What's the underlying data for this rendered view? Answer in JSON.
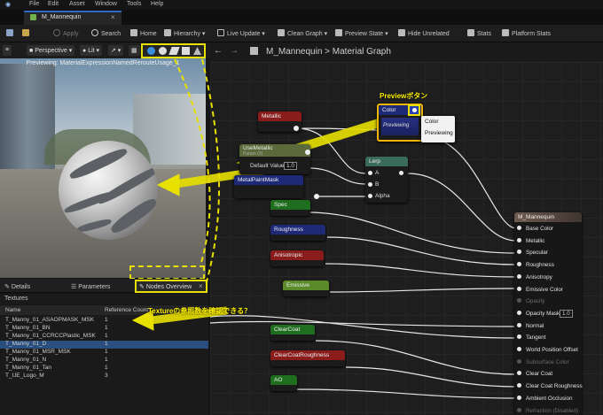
{
  "menu": [
    "File",
    "Edit",
    "Asset",
    "Window",
    "Tools",
    "Help"
  ],
  "tab": {
    "title": "M_Mannequin",
    "close": "×"
  },
  "toolbar": {
    "apply": "Apply",
    "search": "Search",
    "home": "Home",
    "hierarchy": "Hierarchy",
    "live_update": "Live Update",
    "clean_graph": "Clean Graph",
    "preview_state": "Preview State",
    "hide_unrelated": "Hide Unrelated",
    "stats": "Stats",
    "platform_stats": "Platform Stats"
  },
  "viewport": {
    "perspective": "Perspective",
    "lit": "Lit",
    "previewing": "Previewing: MaterialExpressionNamedRerouteUsage_1"
  },
  "panel": {
    "details": "Details",
    "parameters": "Parameters",
    "nodes_overview": "Nodes Overview",
    "close": "×",
    "textures_header": "Textures",
    "col_name": "Name",
    "col_reference": "Reference Count"
  },
  "textures": [
    {
      "name": "T_Manny_01_ASAOPMASK_MSK",
      "count": "1"
    },
    {
      "name": "T_Manny_01_BN",
      "count": "1"
    },
    {
      "name": "T_Manny_01_CCRCCPlastic_MSK",
      "count": "1"
    },
    {
      "name": "T_Manny_01_D",
      "count": "1"
    },
    {
      "name": "T_Manny_01_MSR_MSK",
      "count": "1"
    },
    {
      "name": "T_Manny_01_N",
      "count": "1"
    },
    {
      "name": "T_Manny_01_Tan",
      "count": "1"
    },
    {
      "name": "T_UE_Logo_M",
      "count": "3"
    }
  ],
  "graph": {
    "crumb_root": "M_Mannequin",
    "crumb_sep": ">",
    "crumb_page": "Material Graph"
  },
  "nodes": {
    "metallic": "Metallic",
    "use_metallic": "UseMetallic",
    "use_metallic_sub": "Param (0)",
    "default_value": "Default Value",
    "default_value_num": "1.0",
    "metalpaintmask": "MetalPaintMask",
    "lerp": "Lerp",
    "lerp_a": "A",
    "lerp_b": "B",
    "lerp_alpha": "Alpha",
    "color": "Color",
    "previewing": "Previewing",
    "spec": "Spec",
    "roughness": "Roughness",
    "anisotropic": "Anisotropic",
    "emissive": "Emissive",
    "clearcoat": "ClearCoat",
    "clearcoatroughness": "ClearCoatRoughness",
    "ao": "AO"
  },
  "color_popup": [
    "Color",
    "Previewing"
  ],
  "material": {
    "title": "M_Mannequin",
    "pins": [
      {
        "label": "Base Color",
        "dim": false
      },
      {
        "label": "Metallic",
        "dim": false
      },
      {
        "label": "Specular",
        "dim": false
      },
      {
        "label": "Roughness",
        "dim": false
      },
      {
        "label": "Anisotropy",
        "dim": false
      },
      {
        "label": "Emissive Color",
        "dim": false
      },
      {
        "label": "Opacity",
        "dim": true
      },
      {
        "label": "Opacity Mask",
        "dim": false
      },
      {
        "label": "Normal",
        "dim": false
      },
      {
        "label": "Tangent",
        "dim": false
      },
      {
        "label": "World Position Offset",
        "dim": false
      },
      {
        "label": "Subsurface Color",
        "dim": true
      },
      {
        "label": "Clear Coat",
        "dim": false
      },
      {
        "label": "Clear Coat Roughness",
        "dim": false
      },
      {
        "label": "Ambient Occlusion",
        "dim": false
      },
      {
        "label": "Refraction (Disabled)",
        "dim": true
      }
    ],
    "opacity_mask_value": "1.0"
  },
  "annotations": {
    "preview_button": "Previewボタン",
    "texture_question": "Textureの参照数を確認できる？"
  },
  "colors": {
    "annotation": "#fff200",
    "metallic_node": "#8a1c1c",
    "param_node": "#1e2a78",
    "spec_node": "#1f6e1f",
    "lerp_node": "#3a6b5a",
    "selected": "#f2b600"
  }
}
